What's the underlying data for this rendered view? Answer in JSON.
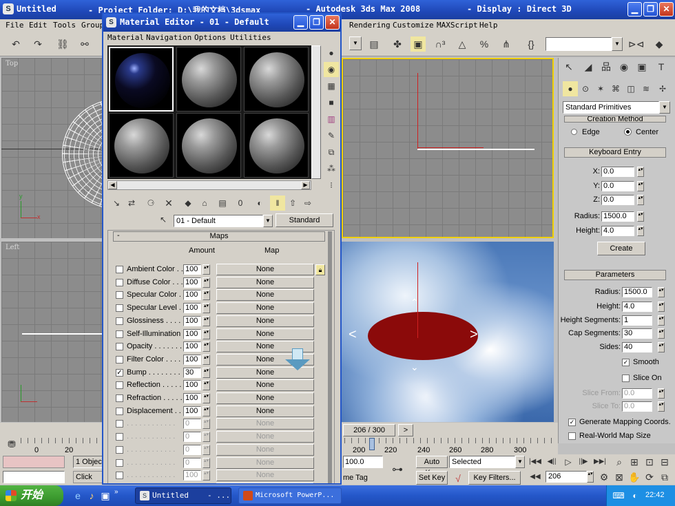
{
  "main_window": {
    "title_parts": [
      "Untitled",
      "- Project Folder: D:\\我的文档\\3dsmax",
      "- Autodesk 3ds Max 2008",
      "- Display : Direct 3D"
    ],
    "menu": [
      "File",
      "Edit",
      "Tools",
      "Group",
      "Rendering",
      "Customize",
      "MAXScript",
      "Help"
    ],
    "toolbar_dropdown": ""
  },
  "viewports": {
    "top_label": "Top",
    "left_label": "Left",
    "axis_x": "x",
    "axis_y": "y"
  },
  "material_editor": {
    "title": "Material Editor - 01 - Default",
    "menu": [
      "Material",
      "Navigation",
      "Options",
      "Utilities"
    ],
    "material_name": "01 - Default",
    "type_button": "Standard",
    "maps_rollout": "Maps",
    "col_amount": "Amount",
    "col_map": "Map",
    "maps": [
      {
        "label": "Ambient Color . . .",
        "amount": "100",
        "map": "None",
        "checked": false,
        "enabled": true
      },
      {
        "label": "Diffuse Color . . .",
        "amount": "100",
        "map": "None",
        "checked": false,
        "enabled": true
      },
      {
        "label": "Specular Color . .",
        "amount": "100",
        "map": "None",
        "checked": false,
        "enabled": true
      },
      {
        "label": "Specular Level .",
        "amount": "100",
        "map": "None",
        "checked": false,
        "enabled": true
      },
      {
        "label": "Glossiness . . . . .",
        "amount": "100",
        "map": "None",
        "checked": false,
        "enabled": true
      },
      {
        "label": "Self-Illumination .",
        "amount": "100",
        "map": "None",
        "checked": false,
        "enabled": true
      },
      {
        "label": "Opacity . . . . . . .",
        "amount": "100",
        "map": "None",
        "checked": false,
        "enabled": true
      },
      {
        "label": "Filter Color . . . .",
        "amount": "100",
        "map": "None",
        "checked": false,
        "enabled": true
      },
      {
        "label": "Bump . . . . . . . .",
        "amount": "30",
        "map": "None",
        "checked": true,
        "enabled": true
      },
      {
        "label": "Reflection . . . . .",
        "amount": "100",
        "map": "None",
        "checked": false,
        "enabled": true
      },
      {
        "label": "Refraction . . . . .",
        "amount": "100",
        "map": "None",
        "checked": false,
        "enabled": true
      },
      {
        "label": "Displacement . .",
        "amount": "100",
        "map": "None",
        "checked": false,
        "enabled": true
      },
      {
        "label": ". . . . . . . . . . . .",
        "amount": "0",
        "map": "None",
        "checked": false,
        "enabled": false
      },
      {
        "label": ". . . . . . . . . . . .",
        "amount": "0",
        "map": "None",
        "checked": false,
        "enabled": false
      },
      {
        "label": ". . . . . . . . . . . .",
        "amount": "0",
        "map": "None",
        "checked": false,
        "enabled": false
      },
      {
        "label": ". . . . . . . . . . . .",
        "amount": "0",
        "map": "None",
        "checked": false,
        "enabled": false
      },
      {
        "label": ". . . . . . . . . . . .",
        "amount": "100",
        "map": "None",
        "checked": false,
        "enabled": false
      },
      {
        "label": ". . . . . . . . . . . .",
        "amount": "100",
        "map": "None",
        "checked": false,
        "enabled": false
      }
    ]
  },
  "command_panel": {
    "category_dropdown": "Standard Primitives",
    "creation_method": "Creation Method",
    "radio_edge": "Edge",
    "radio_center": "Center",
    "keyboard_entry": "Keyboard Entry",
    "kb_x_label": "X:",
    "kb_x": "0.0",
    "kb_y_label": "Y:",
    "kb_y": "0.0",
    "kb_z_label": "Z:",
    "kb_z": "0.0",
    "kb_radius_label": "Radius:",
    "kb_radius": "1500.0",
    "kb_height_label": "Height:",
    "kb_height": "4.0",
    "create_button": "Create",
    "parameters": "Parameters",
    "p_radius_label": "Radius:",
    "p_radius": "1500.0",
    "p_height_label": "Height:",
    "p_height": "4.0",
    "p_hseg_label": "Height Segments:",
    "p_hseg": "1",
    "p_capseg_label": "Cap Segments:",
    "p_capseg": "30",
    "p_sides_label": "Sides:",
    "p_sides": "40",
    "smooth": "Smooth",
    "slice_on": "Slice On",
    "slice_from_label": "Slice From:",
    "slice_from": "0.0",
    "slice_to_label": "Slice To:",
    "slice_to": "0.0",
    "gen_mapping": "Generate Mapping Coords.",
    "real_world": "Real-World Map Size"
  },
  "timeline": {
    "slider_text": "206 / 300",
    "ticks": [
      "0",
      "20",
      "200",
      "220",
      "240",
      "260",
      "280",
      "300"
    ]
  },
  "status": {
    "objects_selected": "1 Objec",
    "prompt": "Click an",
    "field_100": "100.0",
    "auto_key": "Auto Key",
    "selected": "Selected",
    "set_key": "Set Key",
    "key_filters": "Key Filters...",
    "frame": "206",
    "time_tag": "me Tag"
  },
  "taskbar": {
    "start": "开始",
    "task1": "Untitled",
    "task1_more": "- ...",
    "task2": "Microsoft PowerP...",
    "clock": "22:42"
  },
  "colors": {
    "titlebar": "#1f48b8",
    "viewport_grid": "#8c8c8c",
    "active_border": "#f0d000",
    "disc": "#8b0a0a",
    "taskbar": "#2457c9",
    "start_button": "#3c9a2f"
  }
}
